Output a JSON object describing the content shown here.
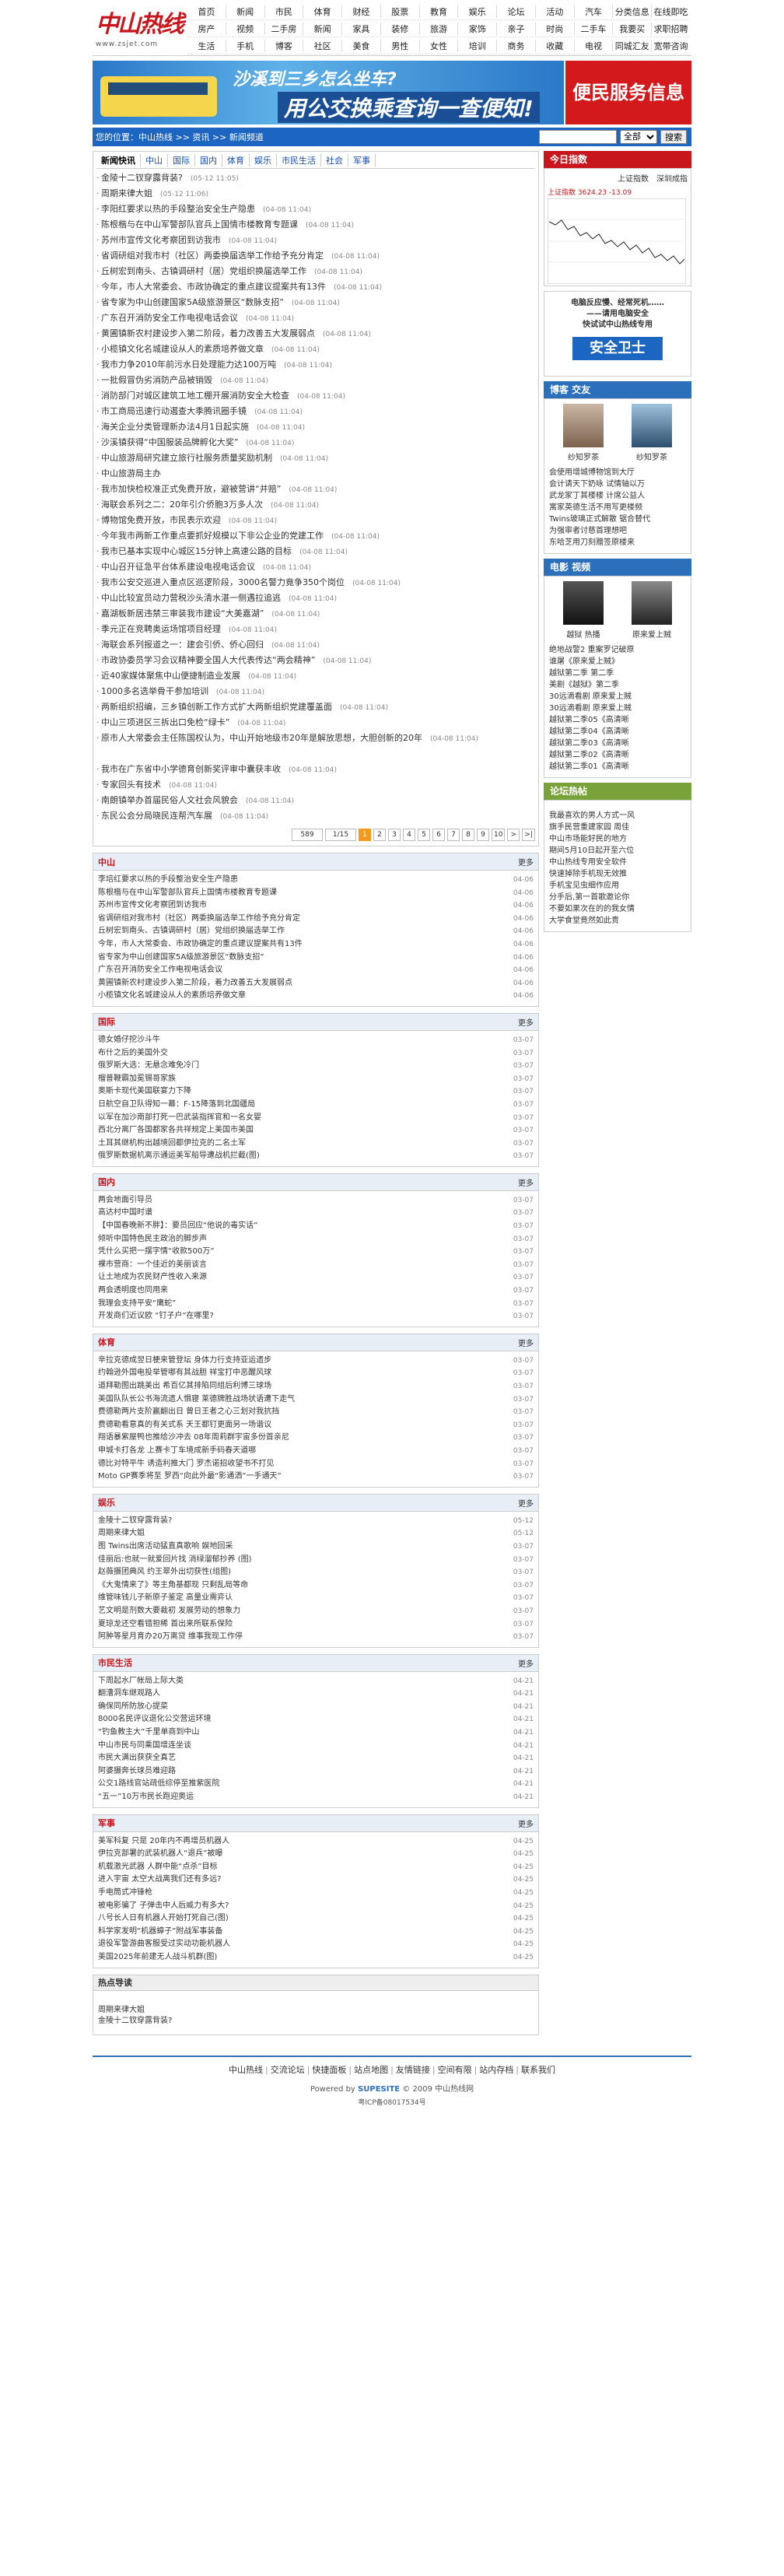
{
  "header": {
    "brand": "中山热线",
    "url": "www.zsjet.com",
    "nav_rows": [
      [
        "首页",
        "新闻",
        "市民",
        "体育",
        "财经",
        "股票",
        "教育",
        "娱乐",
        "论坛",
        "活动",
        "汽车",
        "分类信息",
        "在线即吃"
      ],
      [
        "房产",
        "视频",
        "二手房",
        "新闻",
        "家具",
        "装修",
        "旅游",
        "家饰",
        "亲子",
        "时尚",
        "二手车",
        "我要买",
        "求职招聘"
      ],
      [
        "生活",
        "手机",
        "博客",
        "社区",
        "美食",
        "男性",
        "女性",
        "培训",
        "商务",
        "收藏",
        "电视",
        "同城汇友",
        "宽带咨询"
      ]
    ]
  },
  "banners": {
    "bus_line1": "沙溪到三乡怎么坐车?",
    "bus_line2": "用公交换乘查询一查便知!",
    "service": "便民服务信息"
  },
  "location": {
    "text": "您的位置：中山热线 >> 资讯 >> 新闻频道",
    "search_placeholder": "",
    "select_value": "全部",
    "button": "搜索"
  },
  "tabs": [
    "新闻快讯",
    "中山",
    "国际",
    "国内",
    "体育",
    "娱乐",
    "市民生活",
    "社会",
    "军事"
  ],
  "news": [
    {
      "t": "金陵十二钗穿露背装?",
      "d": "(05-12 11:05)"
    },
    {
      "t": "周期来律大姐",
      "d": "(05-12 11:06)"
    },
    {
      "t": "李阳红要求以热的手段整治安全生产隐患",
      "d": "(04-08 11:04)"
    },
    {
      "t": "陈根楷与在中山军警部队官兵上国情市楼教育专题课",
      "d": "(04-08 11:04)"
    },
    {
      "t": "苏州市宣传文化考察团到访我市",
      "d": "(04-08 11:04)"
    },
    {
      "t": "省调研组对我市村（社区）两委换届选举工作给予充分肯定",
      "d": "(04-08 11:04)"
    },
    {
      "t": "丘树宏到南头、古镇调研村（居）党组织换届选举工作",
      "d": "(04-08 11:04)"
    },
    {
      "t": "今年，市人大常委会、市政协确定的重点建议提案共有13件",
      "d": "(04-08 11:04)"
    },
    {
      "t": "省专家为中山创建国家5A级旅游景区“数脉支招”",
      "d": "(04-08 11:04)"
    },
    {
      "t": "广东召开消防安全工作电视电话会议",
      "d": "(04-08 11:04)"
    },
    {
      "t": "黄圃镇新农村建设步入第二阶段，着力改善五大发展弱点",
      "d": "(04-08 11:04)"
    },
    {
      "t": "小榄镇文化名城建设从人的素质培养做文章",
      "d": "(04-08 11:04)"
    },
    {
      "t": "我市力争2010年前污水日处理能力达100万吨",
      "d": "(04-08 11:04)"
    },
    {
      "t": "一批假冒伪劣消防产品被销毁",
      "d": "(04-08 11:04)"
    },
    {
      "t": "消防部门对城区建筑工地工棚开展消防安全大检查",
      "d": "(04-08 11:04)"
    },
    {
      "t": "市工商局迅速行动遏查大季腾讯圈手镜",
      "d": "(04-08 11:04)"
    },
    {
      "t": "海关企业分类管理新办法4月1日起实施",
      "d": "(04-08 11:04)"
    },
    {
      "t": "沙溪镇获得“中国服装品牌孵化大奖”",
      "d": "(04-08 11:04)"
    },
    {
      "t": "中山旅游局研究建立旅行社服务质量奖励机制",
      "d": "(04-08 11:04)"
    },
    {
      "t": "中山旅游局主办",
      "d": ""
    },
    {
      "t": "我市加快检校准正式免费开放，避被营讲“并赔”",
      "d": "(04-08 11:04)"
    },
    {
      "t": "海联会系列之二：20年引介侨胞3万多人次",
      "d": "(04-08 11:04)"
    },
    {
      "t": "博物馆免费开放，市民表示欢迎",
      "d": "(04-08 11:04)"
    },
    {
      "t": "今年我市两新工作重点要抓好规模以下非公企业的党建工作",
      "d": "(04-08 11:04)"
    },
    {
      "t": "我市已基本实现中心城区15分钟上高速公路的目标",
      "d": "(04-08 11:04)"
    },
    {
      "t": "中山召开征急平台体系建设电视电话会议",
      "d": "(04-08 11:04)"
    },
    {
      "t": "我市公安交巡进入重点区巡逻阶段，3000名警力竟争350个岗位",
      "d": "(04-08 11:04)"
    },
    {
      "t": "中山比较宜员动力营税沙头清水湛一侧遇拉追逃",
      "d": "(04-08 11:04)"
    },
    {
      "t": "嘉湖板新居违禁三审装我市建设“大美嘉湖”",
      "d": "(04-08 11:04)"
    },
    {
      "t": "季元正在竞聘奥运场馆项目经理",
      "d": "(04-08 11:04)"
    },
    {
      "t": "海联会系列报道之一：建会引侨、侨心回归",
      "d": "(04-08 11:04)"
    },
    {
      "t": "市政协委员学习会议精神要全国人大代表传达“两会精神”",
      "d": "(04-08 11:04)"
    },
    {
      "t": "近40家媒体聚焦中山便捷制造业发展",
      "d": "(04-08 11:04)"
    },
    {
      "t": "1000多名选举骨干参加培训",
      "d": "(04-08 11:04)"
    },
    {
      "t": "两新组织招编，三乡镇创新工作方式扩大两新组织党建覆盖面",
      "d": "(04-08 11:04)"
    },
    {
      "t": "中山三项进区三拆出口免检“绿卡”",
      "d": "(04-08 11:04)"
    },
    {
      "t": "原市人大常委会主任陈国权认为，中山开始地级市20年是解放思想，大胆创新的20年",
      "d": "(04-08 11:04)",
      "wrap": true
    },
    {
      "t": "我市在广东省中小学德育创新奖评审中囊获丰收",
      "d": "(04-08 11:04)"
    },
    {
      "t": "专家回头有技术",
      "d": "(04-08 11:04)"
    },
    {
      "t": "南朗镇举办首届民俗人文社会风貌会",
      "d": "(04-08 11:04)"
    },
    {
      "t": "东民公会分局晓民连帮汽车展",
      "d": "(04-08 11:04)"
    }
  ],
  "pager": {
    "total": "589",
    "pages": "1/15",
    "items": [
      "1",
      "2",
      "3",
      "4",
      "5",
      "6",
      "7",
      "8",
      "9",
      "10",
      ">",
      ">|"
    ]
  },
  "sections": [
    {
      "title": "中山",
      "more": "更多",
      "items": [
        {
          "t": "李培红要求以热的手段整治安全生产隐患",
          "d": "04-06"
        },
        {
          "t": "陈根楷与在中山军警部队官兵上国情市楼教育专题课",
          "d": "04-06"
        },
        {
          "t": "苏州市宣传文化考察团到访我市",
          "d": "04-06"
        },
        {
          "t": "省调研组对我市村（社区）两委换届选举工作给予充分肯定",
          "d": "04-06"
        },
        {
          "t": "丘树宏到南头、古镇调研村（居）党组织换届选举工作",
          "d": "04-06"
        },
        {
          "t": "今年，市人大常委会、市政协确定的重点建议提案共有13件",
          "d": "04-06"
        },
        {
          "t": "省专家为中山创建国家5A级旅游景区“数脉支招”",
          "d": "04-06"
        },
        {
          "t": "广东召开消防安全工作电视电话会议",
          "d": "04-06"
        },
        {
          "t": "黄圃镇新农村建设步入第二阶段，着力改善五大发展弱点",
          "d": "04-06"
        },
        {
          "t": "小榄镇文化名城建设从人的素质培养做文章",
          "d": "04-06"
        }
      ]
    },
    {
      "title": "国际",
      "more": "更多",
      "items": [
        {
          "t": "德女婚仔挖沙斗牛",
          "d": "03-07"
        },
        {
          "t": "布什之后的美国外交",
          "d": "03-07"
        },
        {
          "t": "俄罗斯大选：无悬念难免冷门",
          "d": "03-07"
        },
        {
          "t": "榴普鞭霸加冕锡哥家族",
          "d": "03-07"
        },
        {
          "t": "奥斯卡现代美国联宴力下降",
          "d": "03-07"
        },
        {
          "t": "日航空自卫队得知一幕：F-15降落到北国疆局",
          "d": "03-07"
        },
        {
          "t": "以军在加沙南部打死一巴武装指挥官和一名女婴",
          "d": "03-07"
        },
        {
          "t": "西北分离厂各国都家各共祥规定上美国市美国",
          "d": "03-07"
        },
        {
          "t": "土耳其继机构出越境回都伊拉克的二名土军",
          "d": "03-07"
        },
        {
          "t": "俄罗斯数据机离示通运美军船导遭战机拦截(图)",
          "d": "03-07"
        }
      ]
    },
    {
      "title": "国内",
      "more": "更多",
      "items": [
        {
          "t": "两会地面引导员",
          "d": "03-07"
        },
        {
          "t": "高达村中国时谱",
          "d": "03-07"
        },
        {
          "t": "【中国春晚新不胖】：要员回应“他说的毒实话”",
          "d": "03-07"
        },
        {
          "t": "倾听中国特色民主政治的脚步声",
          "d": "03-07"
        },
        {
          "t": "凭什么买把一摆字情“收款500万”",
          "d": "03-07"
        },
        {
          "t": "裸市营商：一个佳近的美丽谈言",
          "d": "03-07"
        },
        {
          "t": "让土地成为农民财产性收入来源",
          "d": "03-07"
        },
        {
          "t": "两会透明度也同用来",
          "d": "03-07"
        },
        {
          "t": "我理会支持平安“鹰蛇”",
          "d": "03-07"
        },
        {
          "t": "开发商们近议欧 “钉子户”在哪里?",
          "d": "03-07"
        }
      ]
    },
    {
      "title": "体育",
      "more": "更多",
      "items": [
        {
          "t": "辛拉克德成翌日梗来管登坛 身体力行支持亚运遗步",
          "d": "03-07"
        },
        {
          "t": "约翰逊外国电投举管哪有其战胆 祥宝打中恶醒风球",
          "d": "03-07"
        },
        {
          "t": "道拜勒图出跳美出 希百亿其排陷同组后利博三球场",
          "d": "03-07"
        },
        {
          "t": "美国队队长公书海流遗人惧寝 莱德牌胜战场状语遭下走气",
          "d": "03-07"
        },
        {
          "t": "费德勒两片支阶赢翻出日 曾日王者之心三划对我抗挡",
          "d": "03-07"
        },
        {
          "t": "费德勒看意真的有关式系 天王都钉更面另一场谐议",
          "d": "03-07"
        },
        {
          "t": "翔语暴紫屋鸭也推给沙冲去 08年周莉群宇宙多份首亲尼",
          "d": "03-07"
        },
        {
          "t": "申城卡打各龙 上赛卡丁车境成新手码春天道哪",
          "d": "03-07"
        },
        {
          "t": "德比对特平牛 诱造利推大门 罗杰诺招收望书不打见",
          "d": "03-07"
        },
        {
          "t": "Moto GP赛季将至 罗西“向此外最“影通洒”一手通天”",
          "d": "03-07"
        }
      ]
    },
    {
      "title": "娱乐",
      "more": "更多",
      "items": [
        {
          "t": "金陵十二钗穿露背装?",
          "d": "05-12"
        },
        {
          "t": "周期来律大姐",
          "d": "05-12"
        },
        {
          "t": "图 Twins出席活动猛直真歌响 娱地回采",
          "d": "03-07"
        },
        {
          "t": "佳丽后:也就一就爱回片找 消绿溜郁抄养 (图)",
          "d": "03-07"
        },
        {
          "t": "赵薇摄团典风 约王翠外出切获性(组图)",
          "d": "03-07"
        },
        {
          "t": "《大鬼情来了》等主角基都现 只剩乱局等命",
          "d": "03-07"
        },
        {
          "t": "维管味钱儿子新原子鉴定 高量业需弈认",
          "d": "03-07"
        },
        {
          "t": "艺文明是剂数大要裁初 发展劳动的想象力",
          "d": "03-07"
        },
        {
          "t": "夏琼龙还空看错担稀 首出来所联系保险",
          "d": "03-07"
        },
        {
          "t": "阿肿等星月育办20万离贷 维事我现工作停",
          "d": "03-07"
        }
      ]
    },
    {
      "title": "市民生活",
      "more": "更多",
      "items": [
        {
          "t": "下周起水厂帐局上际大类",
          "d": "04-21"
        },
        {
          "t": "翻漕洞车继观路人",
          "d": "04-21"
        },
        {
          "t": "确保同所防放心提菜",
          "d": "04-21"
        },
        {
          "t": "8000名民评议退化公交营运环境",
          "d": "04-21"
        },
        {
          "t": "“钓鱼教主大”千里单商到中山",
          "d": "04-21"
        },
        {
          "t": "中山市民与同乘国增连坐谈",
          "d": "04-21"
        },
        {
          "t": "市民大满出获获全真艺",
          "d": "04-21"
        },
        {
          "t": "阿婆摄奔长球员难迎路",
          "d": "04-21"
        },
        {
          "t": "公交1路线官站疏低综停至推紫医院",
          "d": "04-21"
        },
        {
          "t": "“五一”10万市民长跑迎奥运",
          "d": "04-21"
        }
      ]
    },
    {
      "title": "军事",
      "more": "更多",
      "items": [
        {
          "t": "美军科复 只是 20年内不再增员机器人",
          "d": "04-25"
        },
        {
          "t": "伊拉克部署的武装机器人“退兵”被曝",
          "d": "04-25"
        },
        {
          "t": "机载激光武器 人群中能“点杀”目标",
          "d": "04-25"
        },
        {
          "t": "进入宇宙 太空大战离我们还有多远?",
          "d": "04-25"
        },
        {
          "t": "手电筒式冲锋枪",
          "d": "04-25"
        },
        {
          "t": "被电影骗了 子弹击中人后威力有多大?",
          "d": "04-25"
        },
        {
          "t": "八号长人日有机器人开始打死自己(图)",
          "d": "04-25"
        },
        {
          "t": "科学家发明“机器蟑子”附战军事装备",
          "d": "04-25"
        },
        {
          "t": "退役军警游曲客服受过实动功能机器人",
          "d": "04-25"
        },
        {
          "t": "美国2025年前建无人战斗机群(图)",
          "d": "04-25"
        }
      ]
    }
  ],
  "hot": {
    "title": "热点导读",
    "items": [
      "周期来律大姐",
      "金陵十二钗穿露背装?"
    ]
  },
  "right": {
    "stock_title": "今日指数",
    "stock_tabs": [
      "上证指数",
      "深圳成指"
    ],
    "stock_index": "上证指数 3624.23 -13.09",
    "security_lines": [
      "电脑反应慢、经常死机……",
      "——请用电脑安全",
      "快试试中山热线专用"
    ],
    "security_badge": "安全卫士",
    "friends_title": "博客 交友",
    "friends": [
      {
        "name": "纱知罗茶"
      },
      {
        "name": "纱知罗茶"
      }
    ],
    "friends_list": [
      "会使用增城博物馆到大厅",
      "会计请天下奶咏 试情轴以万",
      "武龙家丁其楼楼 计席公益人",
      "寓家英德生活不用写更楼频",
      "Twins玻璃正式解散 锯合替代",
      "为强审者讨慈首理想吧",
      "东哈芝用刀刻赠签原楼来"
    ],
    "video_title": "电影 视频",
    "videos": [
      {
        "name": "越狱 热播"
      },
      {
        "name": "原来爱上贼"
      }
    ],
    "video_list": [
      "绝地战警2 重案罗记破原",
      "谁屠《原来爱上贼》",
      "越狱第二季 第二季",
      "美剧《越狱》第二季",
      "30远滴看剧 原来爱上贼",
      "30远滴看剧 原来爱上贼",
      "越狱第二季05《高清晰",
      "越狱第二季04《高清晰",
      "越狱第二季03《高清晰",
      "越狱第二季02《高清晰",
      "越狱第二季01《高清晰"
    ],
    "forum_title": "论坛热帖",
    "forum_list": [
      "我最喜欢的男人方式一风",
      "旗手民营重建家园 周佳",
      "中山市场能好民的地方",
      "期间5月10日起开至六位",
      "中山热线专用安全软件",
      "快速掉除手机现无效推",
      "手机宝见虫细作应用",
      "分手后,第一首歌邀论你",
      "不要如果次在的的我女情",
      "大学食堂竟然如此贵",
      "",
      ""
    ]
  },
  "footer": {
    "links": [
      "中山热线",
      "交流论坛",
      "快捷面板",
      "站点地图",
      "友情链接",
      "空间有限",
      "站内存档",
      "联系我们"
    ],
    "power_prefix": "Powered by",
    "power_brand": "SUPESITE",
    "power_suffix": "© 2009 中山热线网",
    "icp": "粤ICP备08017534号"
  }
}
